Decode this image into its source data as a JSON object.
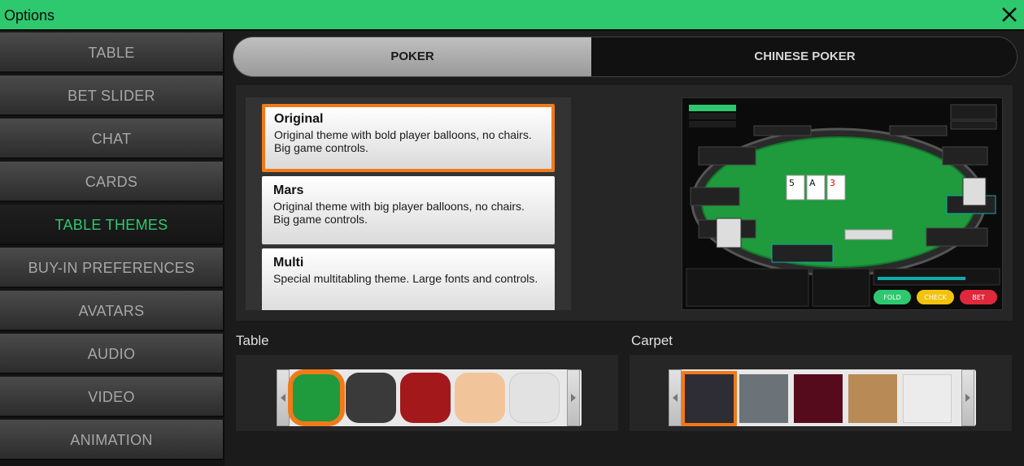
{
  "window": {
    "title": "Options"
  },
  "sidebar": {
    "items": [
      {
        "label": "TABLE"
      },
      {
        "label": "BET SLIDER"
      },
      {
        "label": "CHAT"
      },
      {
        "label": "CARDS"
      },
      {
        "label": "TABLE THEMES",
        "active": true
      },
      {
        "label": "BUY-IN PREFERENCES"
      },
      {
        "label": "AVATARS"
      },
      {
        "label": "AUDIO"
      },
      {
        "label": "VIDEO"
      },
      {
        "label": "ANIMATION"
      }
    ]
  },
  "tabs": [
    {
      "label": "POKER",
      "active": true
    },
    {
      "label": "CHINESE POKER"
    }
  ],
  "themes": [
    {
      "name": "Original",
      "desc": "Original theme with bold player balloons, no chairs. Big game controls.",
      "selected": true
    },
    {
      "name": "Mars",
      "desc": "Original theme with big player balloons, no chairs. Big game controls."
    },
    {
      "name": "Multi",
      "desc": "Special multitabling theme. Large fonts and controls."
    }
  ],
  "preview": {
    "table_colour": "#1f9a3c",
    "cards": [
      "5",
      "A",
      "3"
    ],
    "buttons": [
      "FOLD",
      "CHECK",
      "BET"
    ],
    "button_colours": [
      "#2ec86f",
      "#f2c20f",
      "#e0283c"
    ]
  },
  "table_section": {
    "label": "Table",
    "swatches": [
      "#1f9a3c",
      "#3a3a3a",
      "#a3191b",
      "#f2c49a",
      "#e2e2e2"
    ],
    "selected_index": 0
  },
  "carpet_section": {
    "label": "Carpet",
    "swatches": [
      "#2e2d35",
      "#6c7378",
      "#560b1d",
      "#b88a56",
      "#ececec"
    ],
    "selected_index": 0
  },
  "colors": {
    "accent": "#2ec86f",
    "selection": "#f07a1a"
  }
}
